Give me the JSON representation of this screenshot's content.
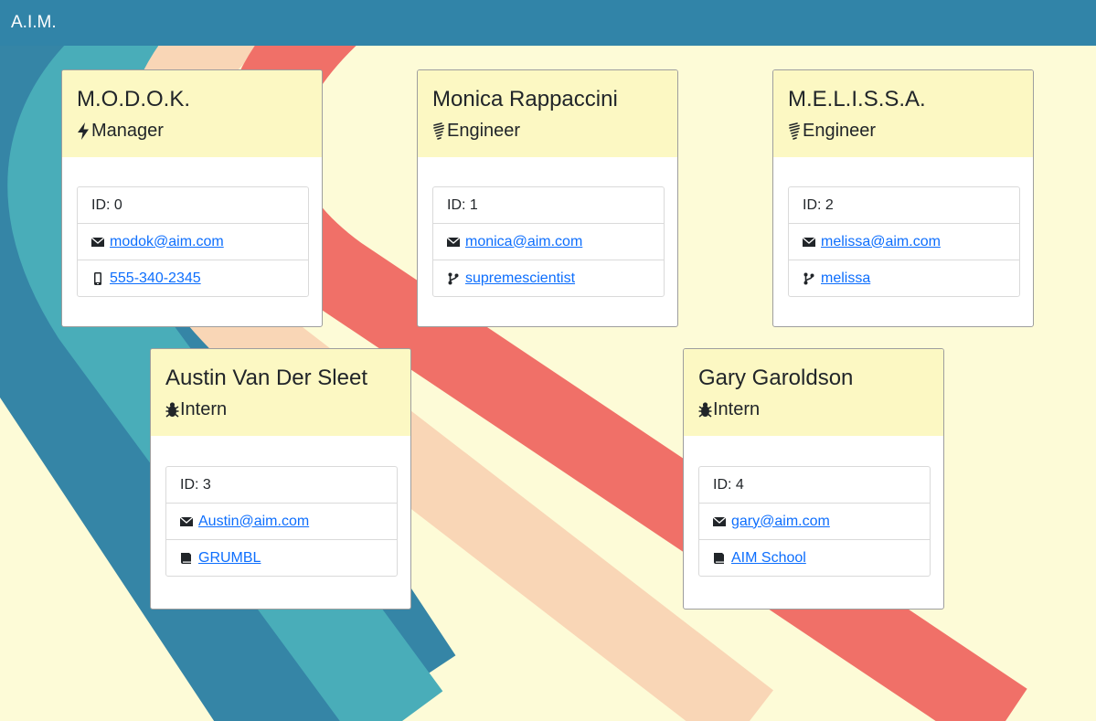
{
  "navbar": {
    "brand": "A.I.M."
  },
  "colors": {
    "navbar": "#3184a8",
    "background": "#fdfbd7",
    "card_header": "#fcf8c3",
    "link": "#0d6efd",
    "stripe_dark_teal": "#3585a6",
    "stripe_teal": "#49adb9",
    "stripe_peach": "#f9d6b6",
    "stripe_coral": "#f07068"
  },
  "cards": [
    {
      "name": "M.O.D.O.K.",
      "role": "Manager",
      "role_icon": "bolt-icon",
      "id_text": "ID: 0",
      "email": "modok@aim.com",
      "extra": "555-340-2345",
      "extra_icon": "phone-icon"
    },
    {
      "name": "Monica Rappaccini",
      "role": "Engineer",
      "role_icon": "lightbulb-icon",
      "id_text": "ID: 1",
      "email": "monica@aim.com",
      "extra": "supremescientist",
      "extra_icon": "git-branch-icon"
    },
    {
      "name": "M.E.L.I.S.S.A.",
      "role": "Engineer",
      "role_icon": "lightbulb-icon",
      "id_text": "ID: 2",
      "email": "melissa@aim.com",
      "extra": "melissa",
      "extra_icon": "git-branch-icon"
    },
    {
      "name": "Austin Van Der Sleet",
      "role": "Intern",
      "role_icon": "bug-icon",
      "id_text": "ID: 3",
      "email": "Austin@aim.com",
      "extra": "GRUMBL",
      "extra_icon": "book-icon"
    },
    {
      "name": "Gary Garoldson",
      "role": "Intern",
      "role_icon": "bug-icon",
      "id_text": "ID: 4",
      "email": "gary@aim.com",
      "extra": "AIM School",
      "extra_icon": "book-icon"
    }
  ]
}
